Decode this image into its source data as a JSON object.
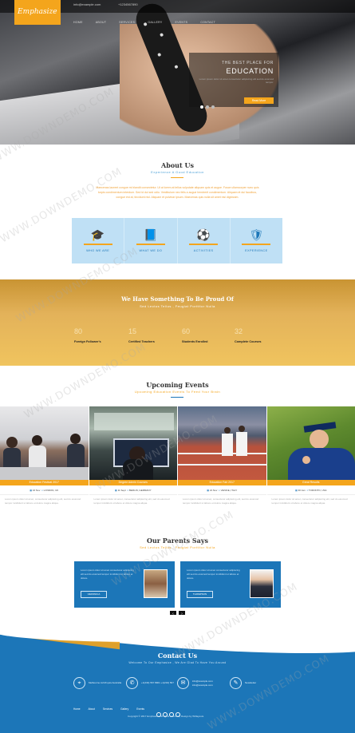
{
  "header": {
    "logo": "Emphasize",
    "email": "info@example.com",
    "phone": "+1234567890",
    "nav": [
      "HOME",
      "ABOUT",
      "SERVICES",
      "GALLERY",
      "EVENTS",
      "CONTACT"
    ]
  },
  "slider": {
    "tagline": "THE BEST PLACE FOR",
    "headline": "EDUCATION",
    "body": "Lorem ipsum dolor sit amet consectetur adipiscing elit sed do eiusmod tempor.",
    "button": "Read More"
  },
  "about": {
    "title": "About Us",
    "subtitle": "Experience A Good Education",
    "body": "Maecenas laoreet congue mi blandit consectetur. Ut at lorem at tellus vulputate aliquam quis et augue. Fusce ullamcorper nunc quis turpis condimentum interdum. Sed id dui sed odio. Vestibulum nec felis a augue hendrerit condimentum. Aliquam et dui faucibus, congue est at, tincidunt nisl. Aliquam et pulvinar ipsum. Maecenas quis nulla sit amet nisi dignissim.",
    "features": [
      {
        "icon": "graduation-cap-icon",
        "glyph": "🎓",
        "label": "WHO WE ARE"
      },
      {
        "icon": "book-icon",
        "glyph": "📘",
        "label": "WHAT WE DO"
      },
      {
        "icon": "football-icon",
        "glyph": "⚽",
        "label": "ACTIVITIES"
      },
      {
        "icon": "shield-icon",
        "glyph": "🛡",
        "label": "EXPERIENCE"
      }
    ]
  },
  "stats": {
    "title": "We Have Something To Be Proud Of",
    "subtitle": "Sed Lectus Tellus , Feugiat Porttitor Nulla",
    "items": [
      {
        "value": "80",
        "label": "Foreign Follower's"
      },
      {
        "value": "15",
        "label": "Certified Teachers"
      },
      {
        "value": "60",
        "label": "Students Enrolled"
      },
      {
        "value": "32",
        "label": "Complete Courses"
      }
    ]
  },
  "events": {
    "title": "Upcoming Events",
    "subtitle": "Upcoming Education Events To Feed Your Brain",
    "items": [
      {
        "caption": "Education Festival 2017",
        "date": "16 Nov",
        "place": "LONDON, UK",
        "text": "Lorem ipsum dolor sit amet, consectetur adipiscing elit, sed do eiusmod tempor incididunt ut labore et dolore magna aliqua."
      },
      {
        "caption": "Degree Admin Courses",
        "date": "11 Sept",
        "place": "BERLIN, GERMANY",
        "text": "Lorem ipsum dolor sit amet, consectetur adipiscing elit, sed do eiusmod tempor incididunt ut labore et dolore magna aliqua."
      },
      {
        "caption": "Education Fair 2017",
        "date": "21 Nov",
        "place": "VENICE, ITALY",
        "text": "Lorem ipsum dolor sit amet, consectetur adipiscing elit, sed do eiusmod tempor incididunt ut labore et dolore magna aliqua."
      },
      {
        "caption": "Great Results",
        "date": "30 Jan",
        "place": "TORONTO, USA",
        "text": "Lorem ipsum dolor sit amet, consectetur adipiscing elit, sed do eiusmod tempor incididunt ut labore et dolore magna aliqua."
      }
    ]
  },
  "parents": {
    "title": "Our Parents Says",
    "subtitle": "Sed Lectus Tellus , Feugiat Porttitor Nulla",
    "items": [
      {
        "quote": "Lorem ipsum dolor sit amet consectetur adipiscing elit sed do eiusmod tempor incididunt ut labore et dolore.",
        "name": "VERONICA"
      },
      {
        "quote": "Lorem ipsum dolor sit amet consectetur adipiscing elit sed do eiusmod tempor incididunt ut labore et dolore.",
        "name": "THOMPSON"
      }
    ],
    "prev": "‹",
    "next": "›"
  },
  "contact": {
    "title": "Contact Us",
    "subtitle": "Welcome To Our Emphasize , We Are Glad To Have You Around",
    "items": [
      {
        "icon": "map-pin-icon",
        "glyph": "⌖",
        "text": "Melbourne Ad Mi quis Australia"
      },
      {
        "icon": "phone-icon",
        "glyph": "✆",
        "text": "+1(234) 567 8901 +1(234) 567"
      },
      {
        "icon": "mail-icon",
        "glyph": "✉",
        "text": "info@example.com info@example.com"
      },
      {
        "icon": "chat-icon",
        "glyph": "✎",
        "text": "Newsletter"
      }
    ],
    "links": [
      "Home",
      "About",
      "Services",
      "Gallery",
      "Events"
    ],
    "copyright": "Copyright © 2017 Emphasize. All rights reserved | Design by W3layouts"
  },
  "watermark": "WWW.DOWNDEMO.COM",
  "colors": {
    "accent": "#f4a51c",
    "brand": "#1c76b8"
  }
}
